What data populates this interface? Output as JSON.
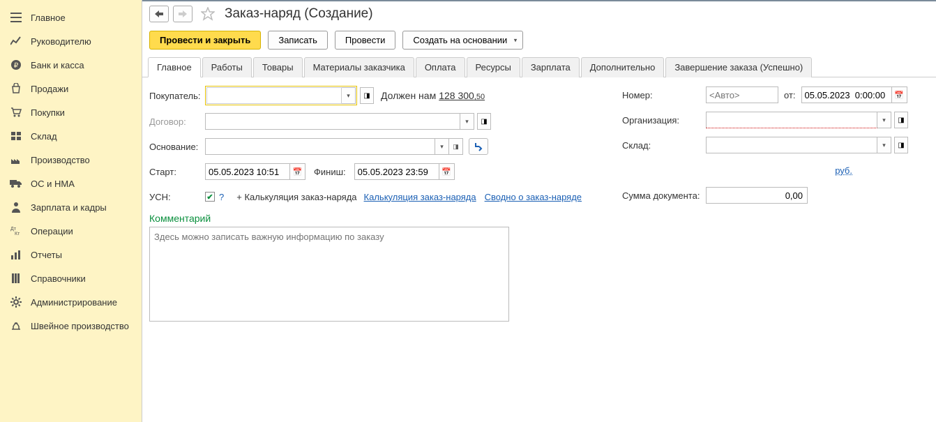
{
  "sidebar": {
    "items": [
      {
        "label": "Главное"
      },
      {
        "label": "Руководителю"
      },
      {
        "label": "Банк и касса"
      },
      {
        "label": "Продажи"
      },
      {
        "label": "Покупки"
      },
      {
        "label": "Склад"
      },
      {
        "label": "Производство"
      },
      {
        "label": "ОС и НМА"
      },
      {
        "label": "Зарплата и кадры"
      },
      {
        "label": "Операции"
      },
      {
        "label": "Отчеты"
      },
      {
        "label": "Справочники"
      },
      {
        "label": "Администрирование"
      },
      {
        "label": "Швейное производство"
      }
    ]
  },
  "header": {
    "title": "Заказ-наряд (Создание)"
  },
  "toolbar": {
    "post_and_close": "Провести и закрыть",
    "save": "Записать",
    "post": "Провести",
    "create_based": "Создать на основании"
  },
  "tabs": [
    {
      "label": "Главное"
    },
    {
      "label": "Работы"
    },
    {
      "label": "Товары"
    },
    {
      "label": "Материалы заказчика"
    },
    {
      "label": "Оплата"
    },
    {
      "label": "Ресурсы"
    },
    {
      "label": "Зарплата"
    },
    {
      "label": "Дополнительно"
    },
    {
      "label": "Завершение заказа (Успешно)"
    }
  ],
  "form": {
    "buyer_label": "Покупатель:",
    "buyer_value": "",
    "debt_text": "Должен нам",
    "debt_amount": "128 300",
    "debt_decimal": ",50",
    "contract_label": "Договор:",
    "contract_value": "",
    "basis_label": "Основание:",
    "basis_value": "",
    "start_label": "Старт:",
    "start_value": "05.05.2023 10:51",
    "finish_label": "Финиш:",
    "finish_value": "05.05.2023 23:59",
    "usn_label": "УСН:",
    "calc_plus": "+ Калькуляция заказ-наряда",
    "calc_link": "Калькуляция заказ-наряда",
    "summary_link": "Сводно о заказ-наряде",
    "comment_label": "Комментарий",
    "comment_placeholder": "Здесь можно записать важную информацию по заказу",
    "number_label": "Номер:",
    "number_placeholder": "<Авто>",
    "from_label": "от:",
    "from_value": "05.05.2023  0:00:00",
    "org_label": "Организация:",
    "org_value": "",
    "warehouse_label": "Склад:",
    "warehouse_value": "",
    "rub": "руб.",
    "sum_label": "Сумма документа:",
    "sum_value": "0,00"
  }
}
